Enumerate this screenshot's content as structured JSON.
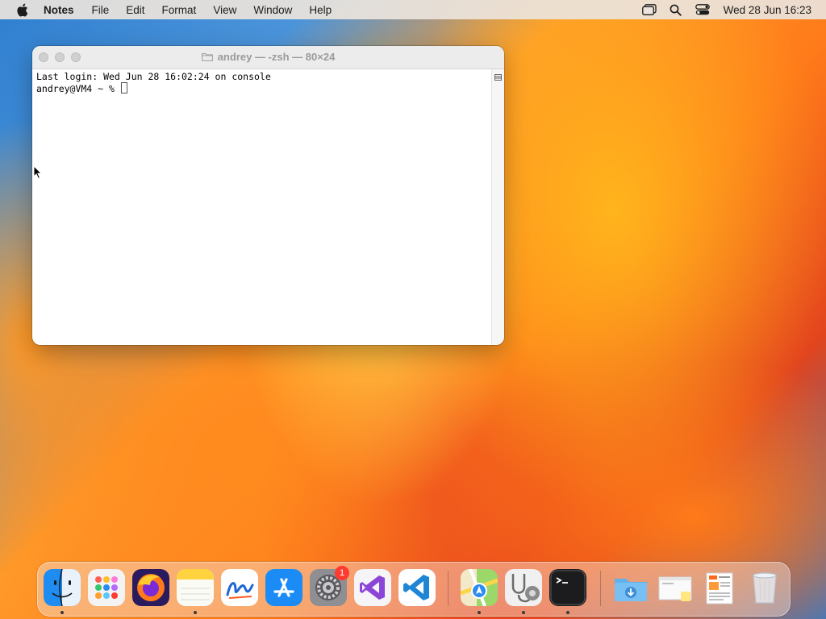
{
  "menubar": {
    "app_name": "Notes",
    "menus": [
      "File",
      "Edit",
      "Format",
      "View",
      "Window",
      "Help"
    ],
    "clock": "Wed 28 Jun  16:23"
  },
  "terminal": {
    "title": "andrey — -zsh — 80×24",
    "lines": [
      "Last login: Wed Jun 28 16:02:24 on console",
      "andrey@VM4 ~ % "
    ]
  },
  "dock": {
    "settings_badge": "1",
    "items": [
      {
        "name": "finder-icon"
      },
      {
        "name": "launchpad-icon"
      },
      {
        "name": "firefox-icon"
      },
      {
        "name": "notes-icon"
      },
      {
        "name": "freeform-icon"
      },
      {
        "name": "app-store-icon"
      },
      {
        "name": "system-settings-icon"
      },
      {
        "name": "visual-studio-icon"
      },
      {
        "name": "vscode-icon"
      },
      {
        "name": "maps-icon"
      },
      {
        "name": "disk-utility-icon"
      },
      {
        "name": "terminal-icon"
      },
      {
        "name": "downloads-folder-icon"
      },
      {
        "name": "screenshot-stack-icon"
      },
      {
        "name": "document-stack-icon"
      },
      {
        "name": "trash-icon"
      }
    ]
  },
  "colors": {
    "menubar_bg": "#ece4dc",
    "settings_badge": "#ff3b30",
    "vscode_blue": "#1f86d6",
    "firefox_orange": "#ff7a1a"
  }
}
